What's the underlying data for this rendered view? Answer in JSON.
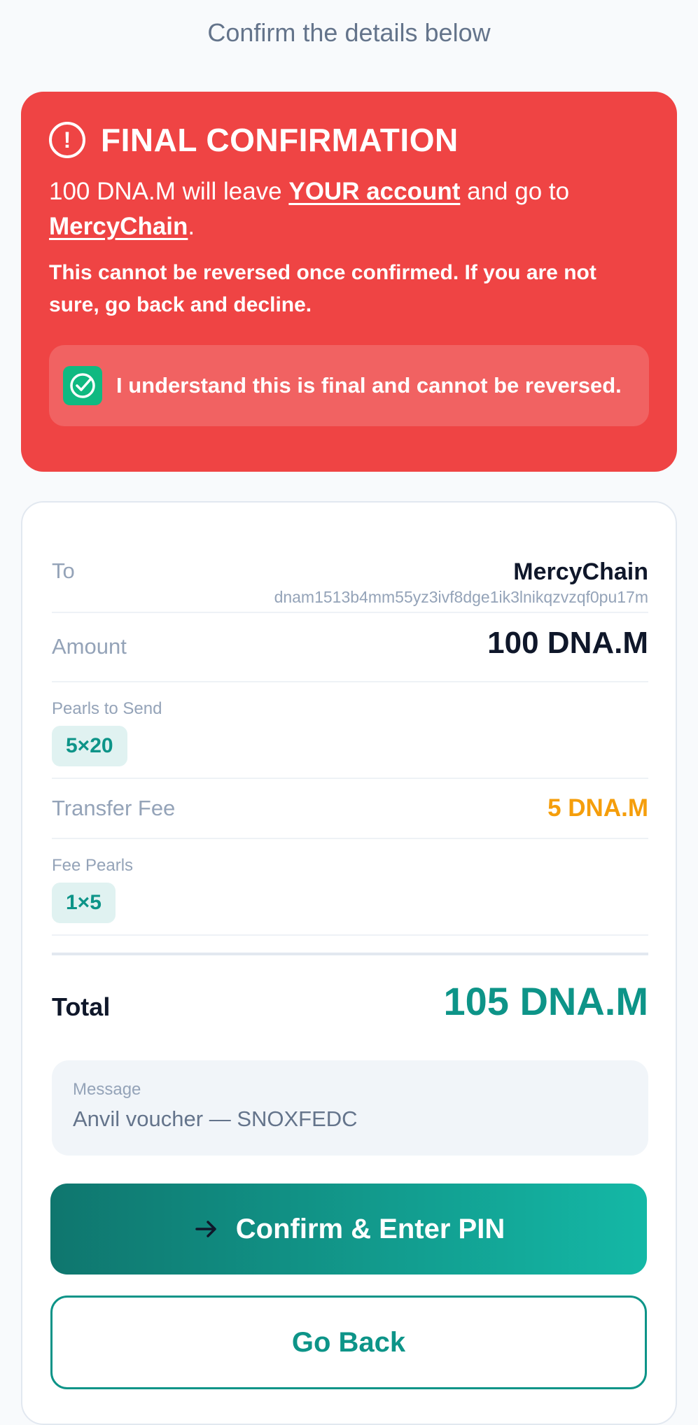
{
  "subtitle": "Confirm the details below",
  "warning": {
    "title": "FINAL CONFIRMATION",
    "line_pre": "100 DNA.M will leave ",
    "line_account": "YOUR account",
    "line_mid": " and go to ",
    "line_recipient": "MercyChain",
    "line_end": ".",
    "note": "This cannot be reversed once confirmed. If you are not sure, go back and decline.",
    "ack_label": "I understand this is final and cannot be reversed.",
    "ack_checked": true
  },
  "details": {
    "to_label": "To",
    "to_name": "MercyChain",
    "to_address": "dnam1513b4mm55yz3ivf8dge1ik3lnikqzvzqf0pu17m",
    "amount_label": "Amount",
    "amount_value": "100 DNA.M",
    "pearls_label": "Pearls to Send",
    "pearls_chip": "5×20",
    "fee_label": "Transfer Fee",
    "fee_value": "5 DNA.M",
    "fee_pearls_label": "Fee Pearls",
    "fee_pearls_chip": "1×5",
    "total_label": "Total",
    "total_value": "105 DNA.M",
    "message_label": "Message",
    "message_value": "Anvil voucher — SNOXFEDC"
  },
  "actions": {
    "confirm_label": "Confirm & Enter PIN",
    "back_label": "Go Back"
  },
  "colors": {
    "warning_bg": "#ef4444",
    "accent": "#0d9488",
    "fee": "#f59e0b",
    "check": "#10b981"
  }
}
